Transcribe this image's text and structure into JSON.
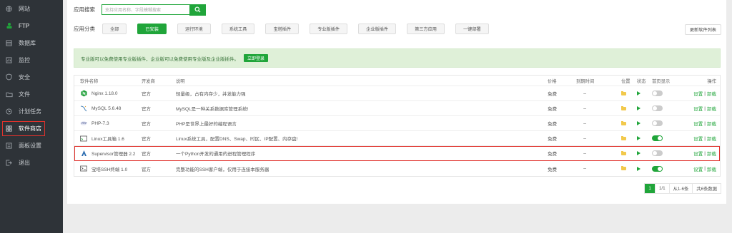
{
  "sidebar": {
    "items": [
      {
        "label": "网站",
        "icon": "globe-icon"
      },
      {
        "label": "FTP",
        "icon": "ftp-icon"
      },
      {
        "label": "数据库",
        "icon": "database-icon"
      },
      {
        "label": "监控",
        "icon": "monitor-icon"
      },
      {
        "label": "安全",
        "icon": "shield-icon"
      },
      {
        "label": "文件",
        "icon": "folder-icon"
      },
      {
        "label": "计划任务",
        "icon": "clock-icon"
      },
      {
        "label": "软件商店",
        "icon": "grid-icon"
      },
      {
        "label": "面板设置",
        "icon": "settings-icon"
      },
      {
        "label": "退出",
        "icon": "logout-icon"
      }
    ]
  },
  "search": {
    "label": "应用搜索",
    "placeholder": "支持应用名称、字段模糊搜索"
  },
  "categories": {
    "label": "应用分类",
    "items": [
      "全部",
      "已安装",
      "运行环境",
      "系统工具",
      "宝塔插件",
      "专业版插件",
      "企业版插件",
      "第三方应用",
      "一键部署"
    ]
  },
  "refresh_label": "更新软件列表",
  "banner": {
    "text": "专业版可以免费使用专业版插件，企业版可以免费使用专业版及企业版插件。",
    "button": "立即登录"
  },
  "table": {
    "headers": {
      "name": "软件名称",
      "dev": "开发商",
      "desc": "说明",
      "price": "价格",
      "expire": "到期时间",
      "location": "位置",
      "status": "状态",
      "home": "首页显示",
      "ops": "操作"
    },
    "rows": [
      {
        "name": "Nginx 1.18.0",
        "dev": "官方",
        "desc": "轻量级，占有内存少，并发能力强",
        "price": "免费",
        "expire": "--",
        "ops_set": "设置",
        "ops_sep": "|",
        "ops_del": "卸载"
      },
      {
        "name": "MySQL 5.6.48",
        "dev": "官方",
        "desc": "MySQL是一种关系数据库管理系统!",
        "price": "免费",
        "expire": "--",
        "ops_set": "设置",
        "ops_sep": "|",
        "ops_del": "卸载"
      },
      {
        "name": "PHP-7.3",
        "dev": "官方",
        "desc": "PHP是世界上最好的编程语言",
        "price": "免费",
        "expire": "--",
        "ops_set": "设置",
        "ops_sep": "|",
        "ops_del": "卸载"
      },
      {
        "name": "Linux工具箱 1.6",
        "dev": "官方",
        "desc": "Linux系统工具，配置DNS、Swap、时区、IP配置、内存盘!",
        "price": "免费",
        "expire": "--",
        "ops_set": "设置",
        "ops_sep": "|",
        "ops_del": "卸载"
      },
      {
        "name": "Supervisor管理器 2.2",
        "dev": "官方",
        "desc": "一个Python开发的通用的进程管理程序",
        "price": "免费",
        "expire": "--",
        "ops_set": "设置",
        "ops_sep": "|",
        "ops_del": "卸载"
      },
      {
        "name": "宝塔SSH终端 1.0",
        "dev": "官方",
        "desc": "完整功能的SSH客户端，仅用于连接本服务器",
        "price": "免费",
        "expire": "--",
        "ops_set": "设置",
        "ops_sep": "|",
        "ops_del": "卸载"
      }
    ]
  },
  "pagination": {
    "current": "1",
    "pages": "1/1",
    "range": "从1-6条",
    "total": "共6条数据"
  },
  "colors": {
    "accent": "#20a53a",
    "sidebar_bg": "#2e3338",
    "highlight": "#e0322c"
  }
}
